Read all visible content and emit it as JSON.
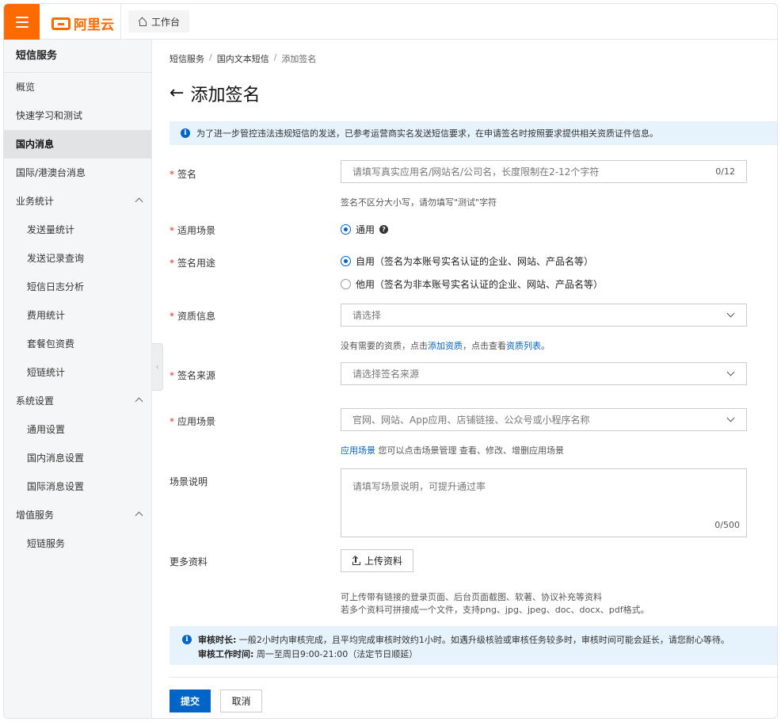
{
  "header": {
    "logo_text": "阿里云",
    "workbench_label": "工作台"
  },
  "sidebar": {
    "title": "短信服务",
    "items": [
      {
        "label": "概览"
      },
      {
        "label": "快速学习和测试"
      },
      {
        "label": "国内消息"
      },
      {
        "label": "国际/港澳台消息"
      },
      {
        "label": "业务统计"
      },
      {
        "label": "发送量统计"
      },
      {
        "label": "发送记录查询"
      },
      {
        "label": "短信日志分析"
      },
      {
        "label": "费用统计"
      },
      {
        "label": "套餐包资费"
      },
      {
        "label": "短链统计"
      },
      {
        "label": "系统设置"
      },
      {
        "label": "通用设置"
      },
      {
        "label": "国内消息设置"
      },
      {
        "label": "国际消息设置"
      },
      {
        "label": "增值服务"
      },
      {
        "label": "短链服务"
      }
    ]
  },
  "breadcrumb": [
    "短信服务",
    "国内文本短信",
    "添加签名"
  ],
  "page": {
    "title": "添加签名",
    "notice": "为了进一步管控违法违规短信的发送，已参考运营商实名发送短信要求，在申请签名时按照要求提供相关资质证件信息。"
  },
  "form": {
    "signature": {
      "label": "签名",
      "placeholder": "请填写真实应用名/网站名/公司名，长度限制在2-12个字符",
      "counter": "0/12",
      "hint": "签名不区分大小写，请勿填写\"测试\"字符"
    },
    "scenario": {
      "label": "适用场景",
      "option": "通用"
    },
    "purpose": {
      "label": "签名用途",
      "option_self": "自用（签名为本账号实名认证的企业、网站、产品名等）",
      "option_other": "他用（签名为非本账号实名认证的企业、网站、产品名等）"
    },
    "qualification": {
      "label": "资质信息",
      "placeholder": "请选择",
      "hint_pre": "没有需要的资质，点击",
      "hint_link1": "添加资质",
      "hint_mid": "，点击查看",
      "hint_link2": "资质列表",
      "hint_post": "。"
    },
    "source": {
      "label": "签名来源",
      "placeholder": "请选择签名来源"
    },
    "app_scene": {
      "label": "应用场景",
      "placeholder": "官网、网站、App应用、店铺链接、公众号或小程序名称",
      "hint_link": "应用场景",
      "hint_text": "您可以点击场景管理 查看、修改、增删应用场景"
    },
    "scene_desc": {
      "label": "场景说明",
      "placeholder": "请填写场景说明，可提升通过率",
      "counter": "0/500"
    },
    "more": {
      "label": "更多资料",
      "upload_label": "上传资料",
      "hint_line1": "可上传带有链接的登录页面、后台页面截图、软著、协议补充等资料",
      "hint_line2": "若多个资料可拼接成一个文件，支持png、jpg、jpeg、doc、docx、pdf格式。"
    }
  },
  "audit": {
    "time_label": "审核时长:",
    "time_text": "一般2小时内审核完成，且平均完成审核时效约1小时。如遇升级核验或审核任务较多时，审核时间可能会延长，请您耐心等待。",
    "hours_label": "审核工作时间:",
    "hours_text": "周一至周日9:00-21:00（法定节日顺延）"
  },
  "actions": {
    "submit": "提交",
    "cancel": "取消"
  }
}
